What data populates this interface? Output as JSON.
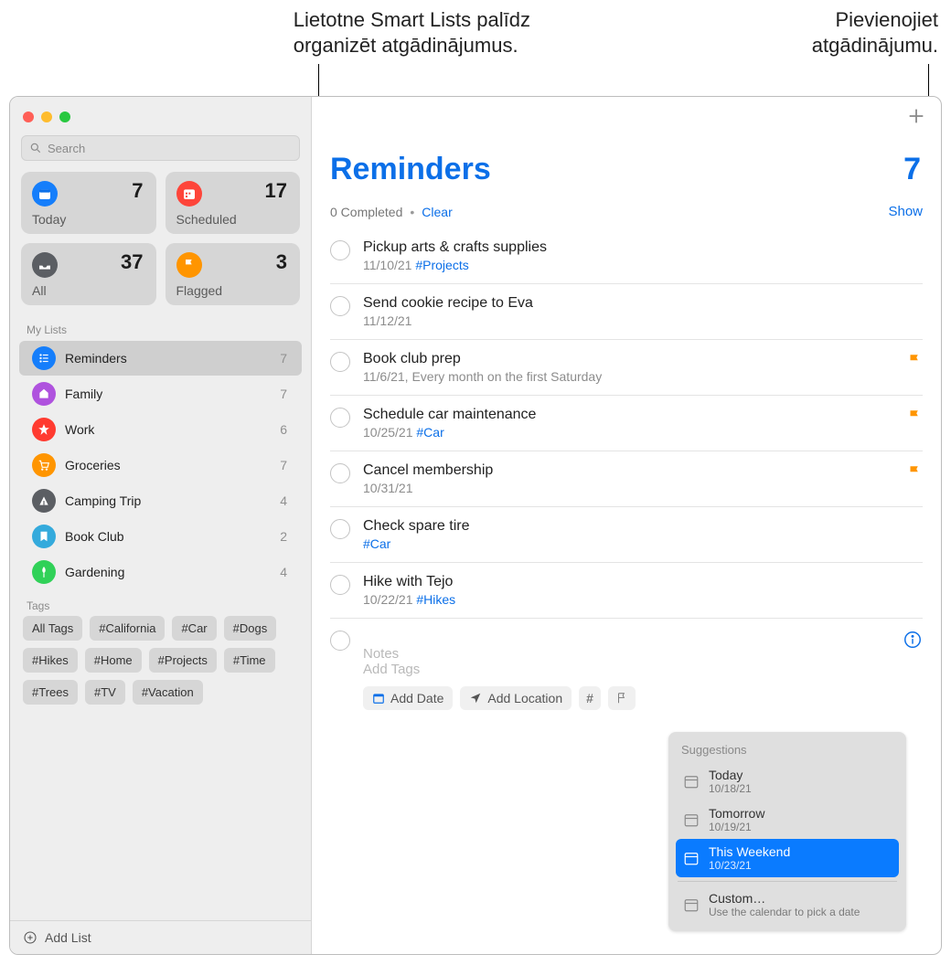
{
  "callouts": {
    "smart_lists": "Lietotne Smart Lists palīdz\norganizēt atgādinājumus.",
    "add_reminder": "Pievienojiet\natgādinājumu."
  },
  "search": {
    "placeholder": "Search"
  },
  "smart": [
    {
      "label": "Today",
      "count": "7",
      "color": "blue"
    },
    {
      "label": "Scheduled",
      "count": "17",
      "color": "red"
    },
    {
      "label": "All",
      "count": "37",
      "color": "grey"
    },
    {
      "label": "Flagged",
      "count": "3",
      "color": "orange"
    }
  ],
  "my_lists_header": "My Lists",
  "lists": [
    {
      "name": "Reminders",
      "count": "7",
      "color": "#157efb",
      "selected": true
    },
    {
      "name": "Family",
      "count": "7",
      "color": "#af52de",
      "selected": false
    },
    {
      "name": "Work",
      "count": "6",
      "color": "#ff3b30",
      "selected": false
    },
    {
      "name": "Groceries",
      "count": "7",
      "color": "#ff9500",
      "selected": false
    },
    {
      "name": "Camping Trip",
      "count": "4",
      "color": "#5b5e63",
      "selected": false
    },
    {
      "name": "Book Club",
      "count": "2",
      "color": "#34aadc",
      "selected": false
    },
    {
      "name": "Gardening",
      "count": "4",
      "color": "#30d158",
      "selected": false
    }
  ],
  "tags_header": "Tags",
  "tags": [
    "All Tags",
    "#California",
    "#Car",
    "#Dogs",
    "#Hikes",
    "#Home",
    "#Projects",
    "#Time",
    "#Trees",
    "#TV",
    "#Vacation"
  ],
  "add_list_label": "Add List",
  "main": {
    "title": "Reminders",
    "count": "7",
    "completed": "0 Completed",
    "clear": "Clear",
    "show": "Show"
  },
  "reminders": [
    {
      "title": "Pickup arts & crafts supplies",
      "date": "11/10/21",
      "tag": "#Projects",
      "flagged": false
    },
    {
      "title": "Send cookie recipe to Eva",
      "date": "11/12/21",
      "tag": "",
      "flagged": false
    },
    {
      "title": "Book club prep",
      "date": "11/6/21, Every month on the first Saturday",
      "tag": "",
      "flagged": true
    },
    {
      "title": "Schedule car maintenance",
      "date": "10/25/21",
      "tag": "#Car",
      "flagged": true
    },
    {
      "title": "Cancel membership",
      "date": "10/31/21",
      "tag": "",
      "flagged": true
    },
    {
      "title": "Check spare tire",
      "date": "",
      "tag": "#Car",
      "flagged": false
    },
    {
      "title": "Hike with Tejo",
      "date": "10/22/21",
      "tag": "#Hikes",
      "flagged": false
    }
  ],
  "new_entry": {
    "notes_placeholder": "Notes",
    "tags_placeholder": "Add Tags",
    "add_date": "Add Date",
    "add_location": "Add Location"
  },
  "suggestions": {
    "header": "Suggestions",
    "items": [
      {
        "title": "Today",
        "sub": "10/18/21",
        "selected": false
      },
      {
        "title": "Tomorrow",
        "sub": "10/19/21",
        "selected": false
      },
      {
        "title": "This Weekend",
        "sub": "10/23/21",
        "selected": true
      }
    ],
    "custom_title": "Custom…",
    "custom_sub": "Use the calendar to pick a date"
  }
}
